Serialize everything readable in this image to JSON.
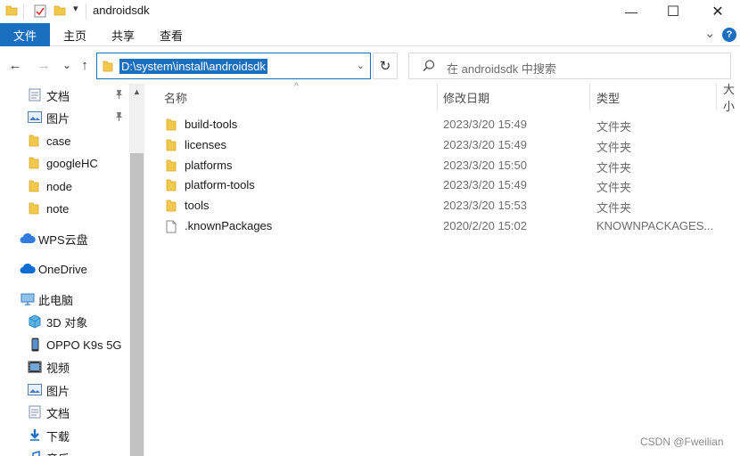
{
  "window": {
    "title": "androidsdk",
    "minimize_glyph": "—",
    "maximize_glyph": "☐",
    "close_glyph": "✕"
  },
  "ribbon": {
    "file_tab": "文件",
    "tabs": [
      "主页",
      "共享",
      "查看"
    ],
    "expand_glyph": "⌄",
    "help_glyph": "?"
  },
  "navigation": {
    "back_glyph": "←",
    "forward_glyph": "→",
    "recent_glyph": "⌄",
    "up_glyph": "↑",
    "address": "D:\\system\\install\\androidsdk",
    "address_dropdown_glyph": "⌄",
    "refresh_glyph": "↻",
    "search_placeholder": "在 androidsdk 中搜索"
  },
  "sidebar": {
    "quick_access": [
      {
        "label": "文档",
        "icon": "documents-icon",
        "pinned": true
      },
      {
        "label": "图片",
        "icon": "pictures-icon",
        "pinned": true
      },
      {
        "label": "case",
        "icon": "folder-icon",
        "pinned": false
      },
      {
        "label": "googleHC",
        "icon": "folder-icon",
        "pinned": false
      },
      {
        "label": "node",
        "icon": "folder-icon",
        "pinned": false
      },
      {
        "label": "note",
        "icon": "folder-icon",
        "pinned": false
      }
    ],
    "wps_cloud": "WPS云盘",
    "onedrive": "OneDrive",
    "this_pc": "此电脑",
    "pc_items": [
      {
        "label": "3D 对象",
        "icon": "3d-objects-icon"
      },
      {
        "label": "OPPO K9s 5G",
        "icon": "phone-icon"
      },
      {
        "label": "视频",
        "icon": "videos-icon"
      },
      {
        "label": "图片",
        "icon": "pictures-icon"
      },
      {
        "label": "文档",
        "icon": "documents-icon"
      },
      {
        "label": "下载",
        "icon": "downloads-icon"
      },
      {
        "label": "音乐",
        "icon": "music-icon"
      }
    ],
    "pin_glyph": "📌"
  },
  "columns": {
    "name": "名称",
    "date": "修改日期",
    "type": "类型",
    "size": "大小"
  },
  "files": [
    {
      "name": "build-tools",
      "date": "2023/3/20 15:49",
      "type": "文件夹",
      "icon": "folder-icon"
    },
    {
      "name": "licenses",
      "date": "2023/3/20 15:49",
      "type": "文件夹",
      "icon": "folder-icon"
    },
    {
      "name": "platforms",
      "date": "2023/3/20 15:50",
      "type": "文件夹",
      "icon": "folder-icon"
    },
    {
      "name": "platform-tools",
      "date": "2023/3/20 15:49",
      "type": "文件夹",
      "icon": "folder-icon"
    },
    {
      "name": "tools",
      "date": "2023/3/20 15:53",
      "type": "文件夹",
      "icon": "folder-icon"
    },
    {
      "name": ".knownPackages",
      "date": "2020/2/20 15:02",
      "type": "KNOWNPACKAGES...",
      "icon": "file-icon"
    }
  ],
  "watermark": "CSDN @Fweilian",
  "colors": {
    "accent": "#1a6fbf",
    "folder": "#f2c94c"
  }
}
